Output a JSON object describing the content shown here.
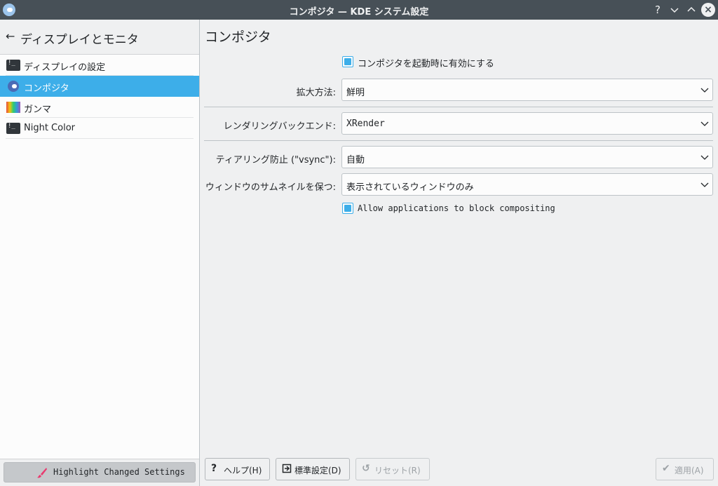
{
  "window": {
    "title": "コンポジタ — KDE システム設定",
    "help_glyph": "?",
    "minimize_glyph": "⌄",
    "maximize_glyph": "⌃",
    "close_glyph": "×"
  },
  "sidebar": {
    "back_glyph": "←",
    "header_title": "ディスプレイとモニタ",
    "items": [
      {
        "label": "ディスプレイの設定",
        "icon": "display-terminal-icon",
        "selected": false
      },
      {
        "label": "コンポジタ",
        "icon": "compositor-icon",
        "selected": true
      },
      {
        "label": "ガンマ",
        "icon": "gamma-icon",
        "selected": false
      },
      {
        "label": "Night Color",
        "icon": "night-color-icon",
        "selected": false
      }
    ],
    "highlight_button": "Highlight Changed Settings"
  },
  "main": {
    "title": "コンポジタ",
    "enable_on_startup": {
      "label": "コンポジタを起動時に有効にする",
      "checked": true
    },
    "scale_method": {
      "label": "拡大方法:",
      "value": "鮮明"
    },
    "rendering_backend": {
      "label": "レンダリングバックエンド:",
      "value": "XRender"
    },
    "tearing_prevention": {
      "label": "ティアリング防止 (\"vsync\"):",
      "value": "自動"
    },
    "keep_thumbnails": {
      "label": "ウィンドウのサムネイルを保つ:",
      "value": "表示されているウィンドウのみ"
    },
    "allow_block": {
      "label": "Allow applications to block compositing",
      "checked": true
    }
  },
  "buttons": {
    "help": "ヘルプ(H)",
    "help_glyph": "?",
    "defaults": "標準設定(D)",
    "reset": "リセット(R)",
    "reset_glyph": "↺",
    "apply": "適用(A)",
    "apply_glyph": "✔"
  },
  "colors": {
    "accent": "#3daee9",
    "titlebar": "#475057",
    "window_bg": "#eff0f1"
  }
}
